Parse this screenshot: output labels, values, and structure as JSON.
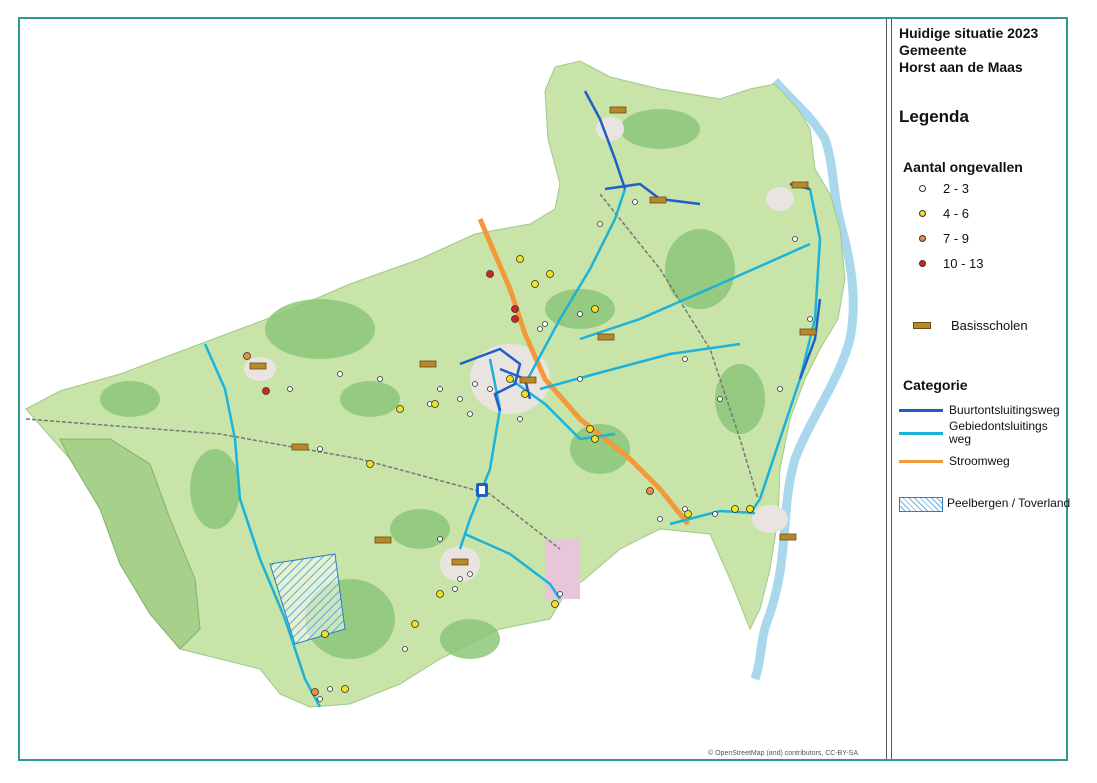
{
  "title": {
    "line1": "Huidige situatie 2023",
    "line2": "Gemeente",
    "line3": "Horst aan de Maas"
  },
  "legend": {
    "heading": "Legenda",
    "accidents_heading": "Aantal ongevallen",
    "accident_classes": [
      {
        "label": "2 - 3",
        "color": "#ffffff"
      },
      {
        "label": "4 - 6",
        "color": "#f2e022"
      },
      {
        "label": "7 - 9",
        "color": "#f08a3c"
      },
      {
        "label": "10 - 13",
        "color": "#d42323"
      }
    ],
    "schools_label": "Basisscholen",
    "category_heading": "Categorie",
    "categories": [
      {
        "label": "Buurtontsluitingsweg",
        "color": "#1f5fc7"
      },
      {
        "label": "Gebiedontsluitings weg",
        "color": "#1bb3d9"
      },
      {
        "label": "Stroomweg",
        "color": "#f29a3a"
      }
    ],
    "zone_label": "Peelbergen / Toverland"
  },
  "credit": "© OpenStreetMap (and) contributors, CC-BY-SA",
  "colors": {
    "frame": "#2e9a8f",
    "land": "#c9e4a9",
    "forest": "#8cc77a",
    "river": "#a9d8ec",
    "urban": "#e9e4e0"
  }
}
